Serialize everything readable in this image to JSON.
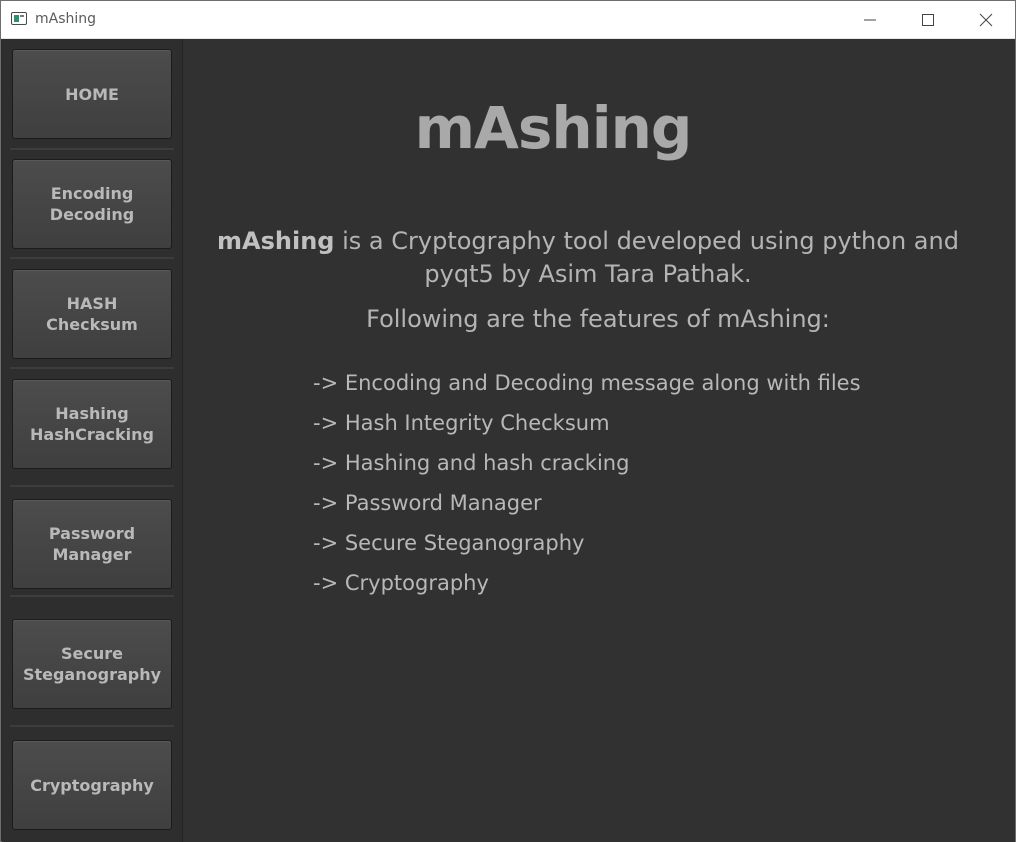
{
  "window": {
    "title": "mAshing"
  },
  "sidebar": {
    "items": [
      {
        "label": "HOME"
      },
      {
        "label": "Encoding\nDecoding"
      },
      {
        "label": "HASH\nChecksum"
      },
      {
        "label": "Hashing\nHashCracking"
      },
      {
        "label": "Password\nManager"
      },
      {
        "label": "Secure\nSteganography"
      },
      {
        "label": "Cryptography"
      }
    ]
  },
  "main": {
    "heading": "mAshing",
    "intro_bold": "mAshing",
    "intro_line1": " is a Cryptography tool developed using python and",
    "intro_line2": "pyqt5 by Asim Tara Pathak.",
    "features_title": "Following are the features of mAshing:",
    "features": [
      "-> Encoding and Decoding message along with files",
      "-> Hash Integrity Checksum",
      "-> Hashing and hash cracking",
      "-> Password Manager",
      "-> Secure Steganography",
      "-> Cryptography"
    ]
  },
  "icons": {
    "app": "app-window-icon",
    "minimize": "minimize-icon",
    "maximize": "maximize-icon",
    "close": "close-icon"
  }
}
